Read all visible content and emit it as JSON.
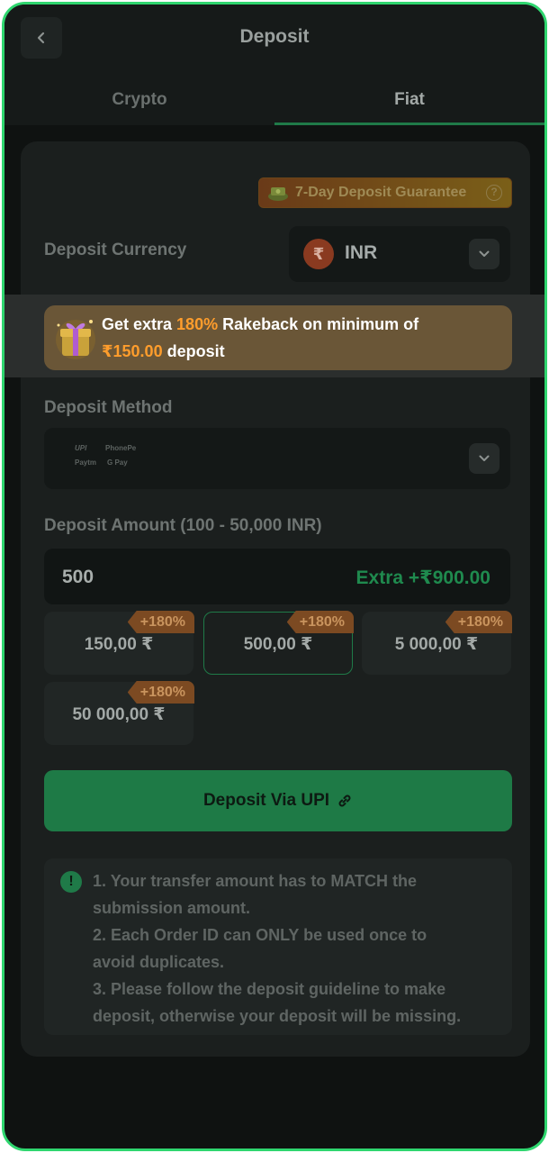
{
  "header": {
    "title": "Deposit",
    "back_icon": "chevron-left-icon"
  },
  "tabs": [
    {
      "label": "Crypto",
      "active": false
    },
    {
      "label": "Fiat",
      "active": true
    }
  ],
  "guarantee": {
    "label": "7-Day Deposit Guarantee",
    "help_icon": "question-circle-icon",
    "help_glyph": "?"
  },
  "currency": {
    "label": "Deposit Currency",
    "symbol": "₹",
    "value": "INR"
  },
  "promo": {
    "prefix": "Get extra ",
    "percent": "180%",
    "middle": " Rakeback on minimum of",
    "amount": "₹150.00",
    "suffix": " deposit"
  },
  "method": {
    "label": "Deposit Method",
    "logos": {
      "upi": "UPI",
      "phonepe": "PhonePe",
      "paytm": "Paytm",
      "gpay": "G Pay"
    }
  },
  "amount": {
    "label": "Deposit Amount (100 - 50,000 INR)",
    "value": "500",
    "extra": "Extra +₹900.00"
  },
  "chips": [
    {
      "value": "150,00 ₹",
      "badge": "+180%",
      "selected": false
    },
    {
      "value": "500,00 ₹",
      "badge": "+180%",
      "selected": true
    },
    {
      "value": "5 000,00 ₹",
      "badge": "+180%",
      "selected": false
    },
    {
      "value": "50 000,00 ₹",
      "badge": "+180%",
      "selected": false
    }
  ],
  "deposit_button": {
    "label": "Deposit Via UPI",
    "icon": "link-icon"
  },
  "notice": {
    "icon_glyph": "!",
    "lines": [
      "1. Your transfer amount has to MATCH the",
      "submission amount.",
      "2. Each Order ID can ONLY be used once to",
      "avoid duplicates.",
      "3. Please follow the deposit guideline to make",
      "deposit, otherwise your deposit will be missing."
    ]
  },
  "colors": {
    "accent": "#1f7a48",
    "frame": "#2fd66f",
    "promo_highlight": "#ff9d2c"
  }
}
